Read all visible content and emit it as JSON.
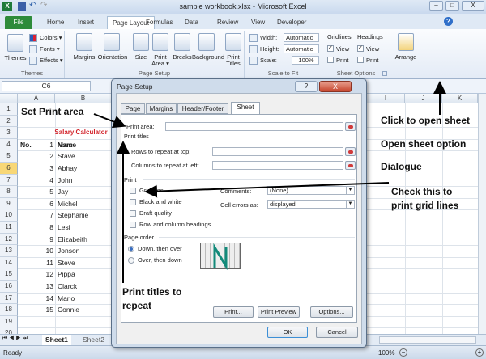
{
  "window": {
    "title": "sample workbook.xlsx - Microsoft Excel",
    "min": "–",
    "max": "□",
    "close": "X"
  },
  "ribbon_tabs": [
    "File",
    "Home",
    "Insert",
    "Page Layout",
    "Formulas",
    "Data",
    "Review",
    "View",
    "Developer"
  ],
  "ribbon": {
    "themes": {
      "themes": "Themes",
      "colors": "Colors ▾",
      "fonts": "Fonts ▾",
      "effects": "Effects ▾",
      "label": "Themes"
    },
    "page_setup": {
      "margins": "Margins",
      "orientation": "Orientation",
      "size": "Size",
      "print_area": "Print Area ▾",
      "breaks": "Breaks",
      "background": "Background",
      "print_titles": "Print Titles",
      "label": "Page Setup"
    },
    "scale_to_fit": {
      "width_label": "Width:",
      "width_value": "Automatic",
      "height_label": "Height:",
      "height_value": "Automatic",
      "scale_label": "Scale:",
      "scale_value": "100%",
      "label": "Scale to Fit"
    },
    "sheet_options": {
      "gridlines": "Gridlines",
      "headings": "Headings",
      "view": "View",
      "print": "Print",
      "label": "Sheet Options",
      "gridlines_view": true,
      "gridlines_print": false,
      "headings_view": true,
      "headings_print": false
    },
    "arrange": "Arrange"
  },
  "name_box": "C6",
  "columns": [
    "A",
    "B",
    "I",
    "J",
    "K"
  ],
  "rows": [
    "1",
    "2",
    "3",
    "4",
    "5",
    "6",
    "7",
    "8",
    "9",
    "10",
    "11",
    "12",
    "13",
    "14",
    "15",
    "16",
    "17",
    "18",
    "19",
    "20"
  ],
  "selected_row": "6",
  "sheet": {
    "title": "Salary Calculator",
    "header_no": "No.",
    "header_name": "Name",
    "data": [
      [
        "1",
        "Marc"
      ],
      [
        "2",
        "Stave"
      ],
      [
        "3",
        "Abhay"
      ],
      [
        "4",
        "John"
      ],
      [
        "5",
        "Jay"
      ],
      [
        "6",
        "Michel"
      ],
      [
        "7",
        "Stephanie"
      ],
      [
        "8",
        "Lesi"
      ],
      [
        "9",
        "Elizabeith"
      ],
      [
        "10",
        "Jonson"
      ],
      [
        "11",
        "Steve"
      ],
      [
        "12",
        "Pippa"
      ],
      [
        "13",
        "Clarck"
      ],
      [
        "14",
        "Mario"
      ],
      [
        "15",
        "Connie"
      ]
    ]
  },
  "sheet_tabs": [
    "Sheet1",
    "Sheet2"
  ],
  "status": {
    "ready": "Ready",
    "zoom": "100%"
  },
  "dialog": {
    "title": "Page Setup",
    "help": "?",
    "close": "X",
    "tabs": [
      "Page",
      "Margins",
      "Header/Footer",
      "Sheet"
    ],
    "active_tab": "Sheet",
    "print_area": "Print area:",
    "print_titles": "Print titles",
    "rows_repeat": "Rows to repeat at top:",
    "cols_repeat": "Columns to repeat at left:",
    "print": "Print",
    "gridlines": "Gridlines",
    "black_white": "Black and white",
    "draft": "Draft quality",
    "row_col_headings": "Row and column headings",
    "comments_label": "Comments:",
    "comments_value": "(None)",
    "cell_errors_label": "Cell errors as:",
    "cell_errors_value": "displayed",
    "page_order": "Page order",
    "down_then_over": "Down, then over",
    "over_then_down": "Over, then down",
    "print_btn": "Print...",
    "preview_btn": "Print Preview",
    "options_btn": "Options...",
    "ok": "OK",
    "cancel": "Cancel"
  },
  "annotations": {
    "set_print_area": "Set Print area",
    "click_open": "Click to open sheet",
    "open_option": "Open sheet option",
    "dialogue": "Dialogue",
    "check1": "Check this to",
    "check2": "print grid lines",
    "titles1": "Print titles to",
    "titles2": "repeat"
  }
}
